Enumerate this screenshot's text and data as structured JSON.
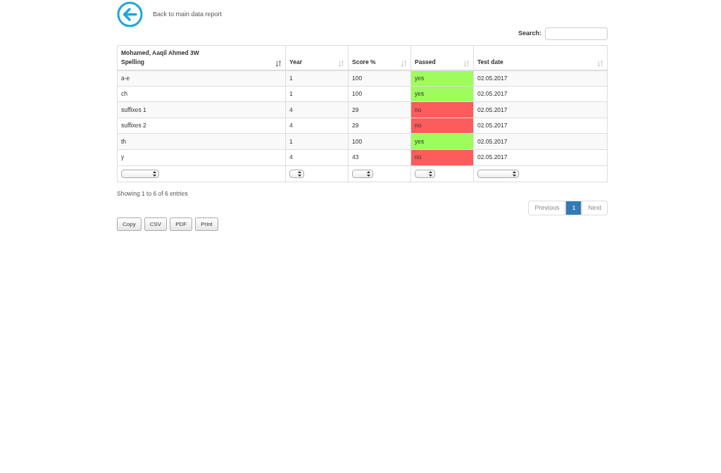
{
  "back_link": "Back to main data report",
  "search": {
    "label": "Search:"
  },
  "table": {
    "columns": [
      {
        "title": "Mohamed, Aaqil Ahmed 3W",
        "subtitle": "Spelling",
        "sorted": true
      },
      {
        "title": "Year",
        "sorted": false
      },
      {
        "title": "Score %",
        "sorted": false
      },
      {
        "title": "Passed",
        "sorted": false
      },
      {
        "title": "Test date",
        "sorted": false
      }
    ],
    "rows": [
      {
        "cells": [
          "a-e",
          "1",
          "100",
          "yes",
          "02.05.2017"
        ],
        "passed": true
      },
      {
        "cells": [
          "ch",
          "1",
          "100",
          "yes",
          "02.05.2017"
        ],
        "passed": true
      },
      {
        "cells": [
          "suffixes 1",
          "4",
          "29",
          "no",
          "02.05.2017"
        ],
        "passed": false
      },
      {
        "cells": [
          "suffixes 2",
          "4",
          "29",
          "no",
          "02.05.2017"
        ],
        "passed": false
      },
      {
        "cells": [
          "th",
          "1",
          "100",
          "yes",
          "02.05.2017"
        ],
        "passed": true
      },
      {
        "cells": [
          "y",
          "4",
          "43",
          "no",
          "02.05.2017"
        ],
        "passed": false
      }
    ]
  },
  "info": "Showing 1 to 6 of 6 entries",
  "pagination": [
    {
      "label": "Previous",
      "kind": "nav",
      "disabled": true
    },
    {
      "label": "1",
      "kind": "page",
      "selected": true
    },
    {
      "label": "Next",
      "kind": "nav",
      "disabled": true
    }
  ],
  "buttons": [
    "Copy",
    "CSV",
    "PDF",
    "Print"
  ]
}
